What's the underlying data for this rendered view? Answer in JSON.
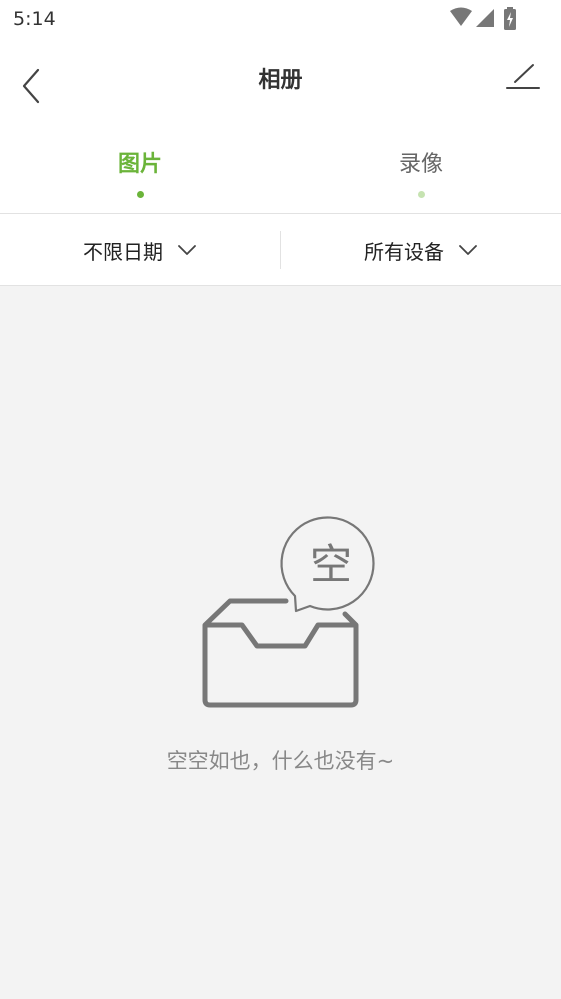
{
  "status_bar": {
    "time": "5:14",
    "icons": [
      "wifi-icon",
      "cell-signal-icon",
      "battery-charging-icon"
    ]
  },
  "header": {
    "title": "相册",
    "back_icon": "back-chevron-icon",
    "edit_icon": "edit-icon"
  },
  "tabs": [
    {
      "label": "图片",
      "active": true
    },
    {
      "label": "录像",
      "active": false
    }
  ],
  "filters": [
    {
      "label": "不限日期",
      "icon": "chevron-down-icon"
    },
    {
      "label": "所有设备",
      "icon": "chevron-down-icon"
    }
  ],
  "empty_state": {
    "bubble_char": "空",
    "message": "空空如也，什么也没有~"
  },
  "colors": {
    "accent": "#6bb43a",
    "accent_light": "#c6e3b1",
    "background": "#f3f3f3",
    "illustration": "#777777"
  }
}
